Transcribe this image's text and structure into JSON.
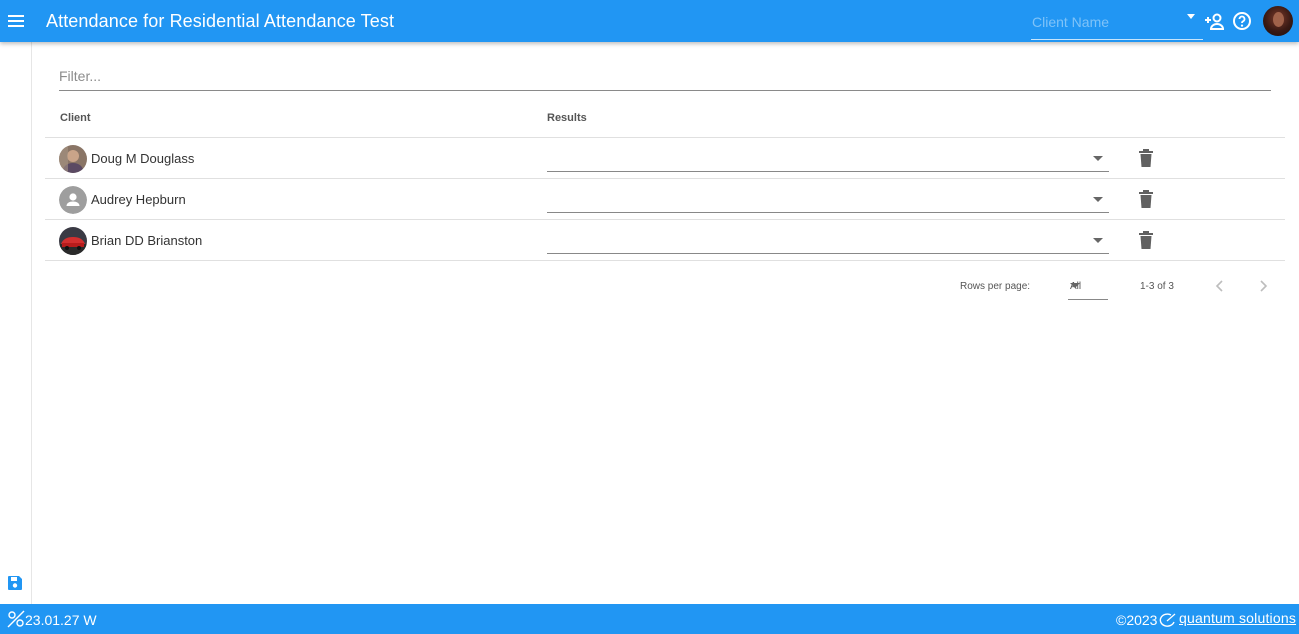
{
  "header": {
    "title": "Attendance for Residential Attendance Test",
    "client_placeholder": "Client Name"
  },
  "filter": {
    "placeholder": "Filter..."
  },
  "table": {
    "columns": [
      "Client",
      "Results"
    ],
    "rows": [
      {
        "name": "Doug M Douglass",
        "avatar": "photo-avatar",
        "result": ""
      },
      {
        "name": "Audrey Hepburn",
        "avatar": "default-person-avatar",
        "result": ""
      },
      {
        "name": "Brian DD Brianston",
        "avatar": "photo-avatar-car",
        "result": ""
      }
    ]
  },
  "pagination": {
    "rows_per_page_label": "Rows per page:",
    "rows_per_page_value": "All",
    "range": "1-3 of 3"
  },
  "footer": {
    "version": "23.01.27 W",
    "copyright": "©2023",
    "brand": "quantum solutions"
  },
  "colors": {
    "primary": "#2196f3",
    "icon_gray": "#616161",
    "placeholder_on_primary": "#7fc3f8"
  }
}
